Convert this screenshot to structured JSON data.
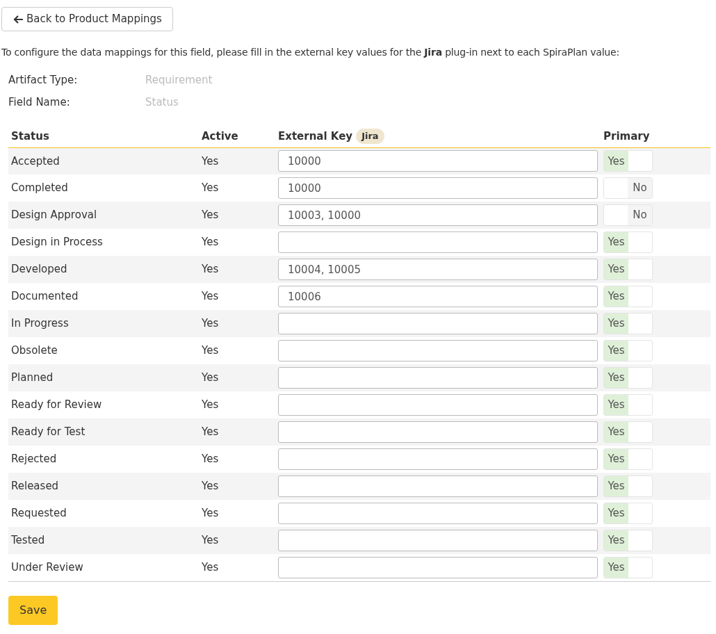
{
  "back_button": {
    "label": "Back to Product Mappings"
  },
  "intro": "To configure the data mappings for this field, please fill in the external key values for the **Jira** plug-in next to each SpiraPlan value:",
  "details": [
    {
      "label": "Artifact Type:",
      "value": "Requirement"
    },
    {
      "label": "Field Name:",
      "value": "Status"
    }
  ],
  "table": {
    "columns": {
      "status": "Status",
      "active": "Active",
      "external_key": "External Key",
      "plugin_badge": "Jira",
      "primary": "Primary"
    },
    "rows": [
      {
        "status": "Accepted",
        "active": "Yes",
        "external_key": "10000",
        "primary_on": true,
        "primary_label": "Yes"
      },
      {
        "status": "Completed",
        "active": "Yes",
        "external_key": "10000",
        "primary_on": false,
        "primary_label": "No"
      },
      {
        "status": "Design Approval",
        "active": "Yes",
        "external_key": "10003, 10000",
        "primary_on": false,
        "primary_label": "No"
      },
      {
        "status": "Design in Process",
        "active": "Yes",
        "external_key": "",
        "primary_on": true,
        "primary_label": "Yes"
      },
      {
        "status": "Developed",
        "active": "Yes",
        "external_key": "10004, 10005",
        "primary_on": true,
        "primary_label": "Yes"
      },
      {
        "status": "Documented",
        "active": "Yes",
        "external_key": "10006",
        "primary_on": true,
        "primary_label": "Yes"
      },
      {
        "status": "In Progress",
        "active": "Yes",
        "external_key": "",
        "primary_on": true,
        "primary_label": "Yes"
      },
      {
        "status": "Obsolete",
        "active": "Yes",
        "external_key": "",
        "primary_on": true,
        "primary_label": "Yes"
      },
      {
        "status": "Planned",
        "active": "Yes",
        "external_key": "",
        "primary_on": true,
        "primary_label": "Yes"
      },
      {
        "status": "Ready for Review",
        "active": "Yes",
        "external_key": "",
        "primary_on": true,
        "primary_label": "Yes"
      },
      {
        "status": "Ready for Test",
        "active": "Yes",
        "external_key": "",
        "primary_on": true,
        "primary_label": "Yes"
      },
      {
        "status": "Rejected",
        "active": "Yes",
        "external_key": "",
        "primary_on": true,
        "primary_label": "Yes"
      },
      {
        "status": "Released",
        "active": "Yes",
        "external_key": "",
        "primary_on": true,
        "primary_label": "Yes"
      },
      {
        "status": "Requested",
        "active": "Yes",
        "external_key": "",
        "primary_on": true,
        "primary_label": "Yes"
      },
      {
        "status": "Tested",
        "active": "Yes",
        "external_key": "",
        "primary_on": true,
        "primary_label": "Yes"
      },
      {
        "status": "Under Review",
        "active": "Yes",
        "external_key": "",
        "primary_on": true,
        "primary_label": "Yes"
      }
    ]
  },
  "save_button": {
    "label": "Save"
  }
}
